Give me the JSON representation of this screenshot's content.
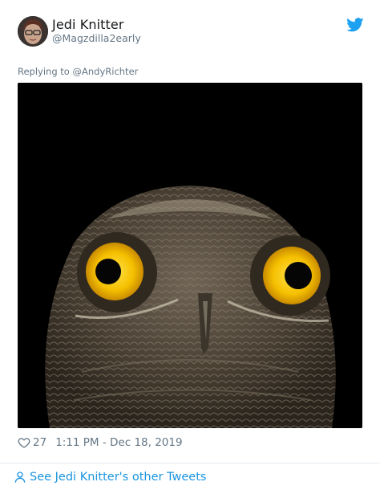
{
  "tweet": {
    "author_name": "Jedi Knitter",
    "author_handle": "@Magzdilla2early",
    "replying_prefix": "Replying to",
    "replying_to": "@AndyRichter",
    "like_count": "27",
    "timestamp": "1:11 PM - Dec 18, 2019"
  },
  "footer": {
    "see_more_label": "See Jedi Knitter's other Tweets"
  },
  "icons": {
    "logo": "twitter-bird-icon",
    "like": "heart-outline-icon",
    "profile": "person-icon"
  },
  "colors": {
    "brand": "#1da1f2",
    "link": "#1b95e0",
    "muted": "#657786",
    "text": "#14171a"
  }
}
